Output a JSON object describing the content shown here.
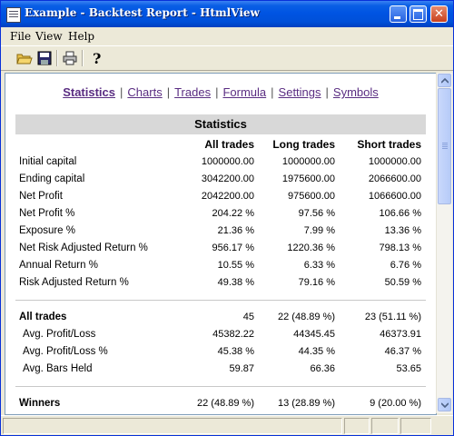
{
  "window": {
    "title": "Example - Backtest Report - HtmlView"
  },
  "menu": [
    "File",
    "View",
    "Help"
  ],
  "toolbar": {
    "icons": [
      "open-folder-icon",
      "save-icon",
      "print-icon",
      "help-icon"
    ]
  },
  "nav": {
    "links": [
      "Statistics",
      "Charts",
      "Trades",
      "Formula",
      "Settings",
      "Symbols"
    ],
    "separator": "|",
    "active": "Statistics"
  },
  "report": {
    "heading": "Statistics",
    "columns": [
      "All trades",
      "Long trades",
      "Short trades"
    ],
    "section1": [
      {
        "label": "Initial capital",
        "values": [
          "1000000.00",
          "1000000.00",
          "1000000.00"
        ]
      },
      {
        "label": "Ending capital",
        "values": [
          "3042200.00",
          "1975600.00",
          "2066600.00"
        ]
      },
      {
        "label": "Net Profit",
        "values": [
          "2042200.00",
          "975600.00",
          "1066600.00"
        ]
      },
      {
        "label": "Net Profit %",
        "values": [
          "204.22 %",
          "97.56 %",
          "106.66 %"
        ]
      },
      {
        "label": "Exposure %",
        "values": [
          "21.36 %",
          "7.99 %",
          "13.36 %"
        ]
      },
      {
        "label": "Net Risk Adjusted Return %",
        "values": [
          "956.17 %",
          "1220.36 %",
          "798.13 %"
        ]
      },
      {
        "label": "Annual Return %",
        "values": [
          "10.55 %",
          "6.33 %",
          "6.76 %"
        ]
      },
      {
        "label": "Risk Adjusted Return %",
        "values": [
          "49.38 %",
          "79.16 %",
          "50.59 %"
        ]
      }
    ],
    "section2": [
      {
        "label": "All trades",
        "bold": true,
        "values": [
          "45",
          "22 (48.89 %)",
          "23 (51.11 %)"
        ]
      },
      {
        "label": "Avg. Profit/Loss",
        "values": [
          "45382.22",
          "44345.45",
          "46373.91"
        ]
      },
      {
        "label": "Avg. Profit/Loss %",
        "values": [
          "45.38 %",
          "44.35 %",
          "46.37 %"
        ]
      },
      {
        "label": "Avg. Bars Held",
        "values": [
          "59.87",
          "66.36",
          "53.65"
        ]
      }
    ],
    "section3": [
      {
        "label": "Winners",
        "bold": true,
        "values": [
          "22 (48.89 %)",
          "13 (28.89 %)",
          "9 (20.00 %)"
        ]
      }
    ]
  },
  "colors": {
    "title_bar": "#0054e3",
    "link": "#5a2d82",
    "header_band": "#d8d8d8",
    "window_bg": "#ece9d8"
  }
}
